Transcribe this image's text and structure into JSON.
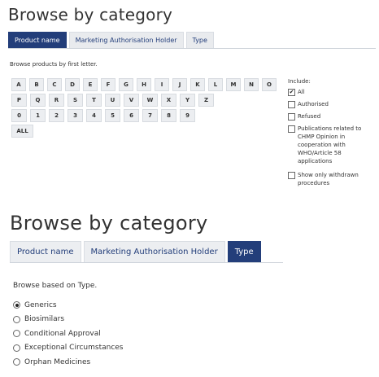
{
  "top": {
    "heading": "Browse by category",
    "tabs": [
      "Product name",
      "Marketing Authorisation Holder",
      "Type"
    ],
    "active_tab": 0,
    "browse_label": "Browse products by first letter.",
    "letter_rows": [
      [
        "A",
        "B",
        "C",
        "D",
        "E",
        "F",
        "G",
        "H",
        "I",
        "J",
        "K",
        "L",
        "M",
        "N",
        "O"
      ],
      [
        "P",
        "Q",
        "R",
        "S",
        "T",
        "U",
        "V",
        "W",
        "X",
        "Y",
        "Z"
      ],
      [
        "0",
        "1",
        "2",
        "3",
        "4",
        "5",
        "6",
        "7",
        "8",
        "9"
      ],
      [
        "ALL"
      ]
    ],
    "include": {
      "label": "Include:",
      "options": [
        {
          "label": "All",
          "checked": true
        },
        {
          "label": "Authorised",
          "checked": false
        },
        {
          "label": "Refused",
          "checked": false
        },
        {
          "label": "Publications related to CHMP Opinion in cooperation with WHO/Article 58 applications",
          "checked": false
        },
        {
          "label": "Show only withdrawn procedures",
          "checked": false
        }
      ]
    }
  },
  "bottom": {
    "heading": "Browse by category",
    "tabs": [
      "Product name",
      "Marketing Authorisation Holder",
      "Type"
    ],
    "active_tab": 2,
    "browse_label": "Browse based on Type.",
    "radios": [
      {
        "label": "Generics",
        "selected": true
      },
      {
        "label": "Biosimilars",
        "selected": false
      },
      {
        "label": "Conditional Approval",
        "selected": false
      },
      {
        "label": "Exceptional Circumstances",
        "selected": false
      },
      {
        "label": "Orphan Medicines",
        "selected": false
      }
    ]
  }
}
